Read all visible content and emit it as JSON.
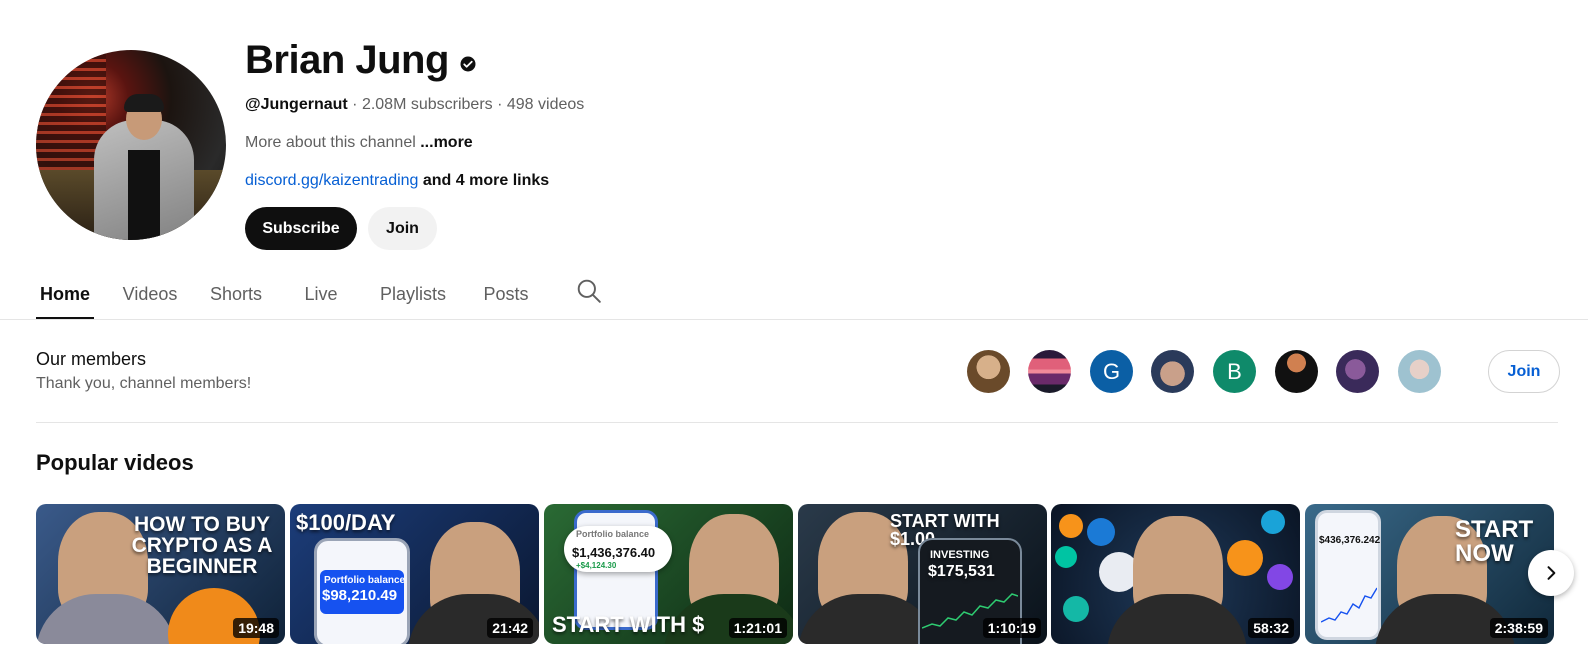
{
  "channel": {
    "name": "Brian Jung",
    "handle": "@Jungernaut",
    "subscribers": "2.08M subscribers",
    "videos": "498 videos",
    "separator": " · ",
    "about": "More about this channel",
    "about_more": " ...more",
    "link": "discord.gg/kaizentrading",
    "link_rest": " and 4 more links",
    "subscribe_label": "Subscribe",
    "join_label": "Join"
  },
  "tabs": [
    {
      "label": "Home",
      "active": true
    },
    {
      "label": "Videos",
      "active": false
    },
    {
      "label": "Shorts",
      "active": false
    },
    {
      "label": "Live",
      "active": false
    },
    {
      "label": "Playlists",
      "active": false
    },
    {
      "label": "Posts",
      "active": false
    }
  ],
  "members": {
    "title": "Our members",
    "subtitle": "Thank you, channel members!",
    "join_label": "Join",
    "avatars": [
      {
        "kind": "photo",
        "color": "#8a6a4a",
        "letter": ""
      },
      {
        "kind": "photo",
        "color": "#d9557a",
        "letter": ""
      },
      {
        "kind": "letter",
        "color": "#0b5fa5",
        "letter": "G"
      },
      {
        "kind": "photo",
        "color": "#a07a66",
        "letter": ""
      },
      {
        "kind": "letter",
        "color": "#0f8a6a",
        "letter": "B"
      },
      {
        "kind": "photo",
        "color": "#1a1a1a",
        "letter": ""
      },
      {
        "kind": "photo",
        "color": "#6a4a8a",
        "letter": ""
      },
      {
        "kind": "photo",
        "color": "#cfdde6",
        "letter": ""
      }
    ]
  },
  "popular": {
    "title": "Popular videos",
    "videos": [
      {
        "duration": "19:48",
        "text": "HOW TO BUY CRYPTO AS A BEGINNER",
        "bg": "#1f3a5a"
      },
      {
        "duration": "21:42",
        "text": "$100/DAY",
        "sub": "Portfolio balance",
        "amount": "$98,210.49",
        "bg": "#123060"
      },
      {
        "duration": "1:21:01",
        "text": "START WITH $",
        "sub": "Portfolio balance",
        "amount": "$1,436,376.40",
        "delta": "+$4,124.30",
        "bg": "#1d5a2a"
      },
      {
        "duration": "1:10:19",
        "text": "START WITH $1.00",
        "sub": "INVESTING",
        "amount": "$175,531",
        "bg": "#1b2a3a"
      },
      {
        "duration": "58:32",
        "text": "",
        "bg": "#0f1e33"
      },
      {
        "duration": "2:38:59",
        "text": "START NOW",
        "amount": "$436,376.242",
        "bg": "#24506a"
      }
    ]
  },
  "icons": {
    "verified": "verified-badge-icon",
    "search": "search-icon",
    "next": "chevron-right-icon"
  }
}
